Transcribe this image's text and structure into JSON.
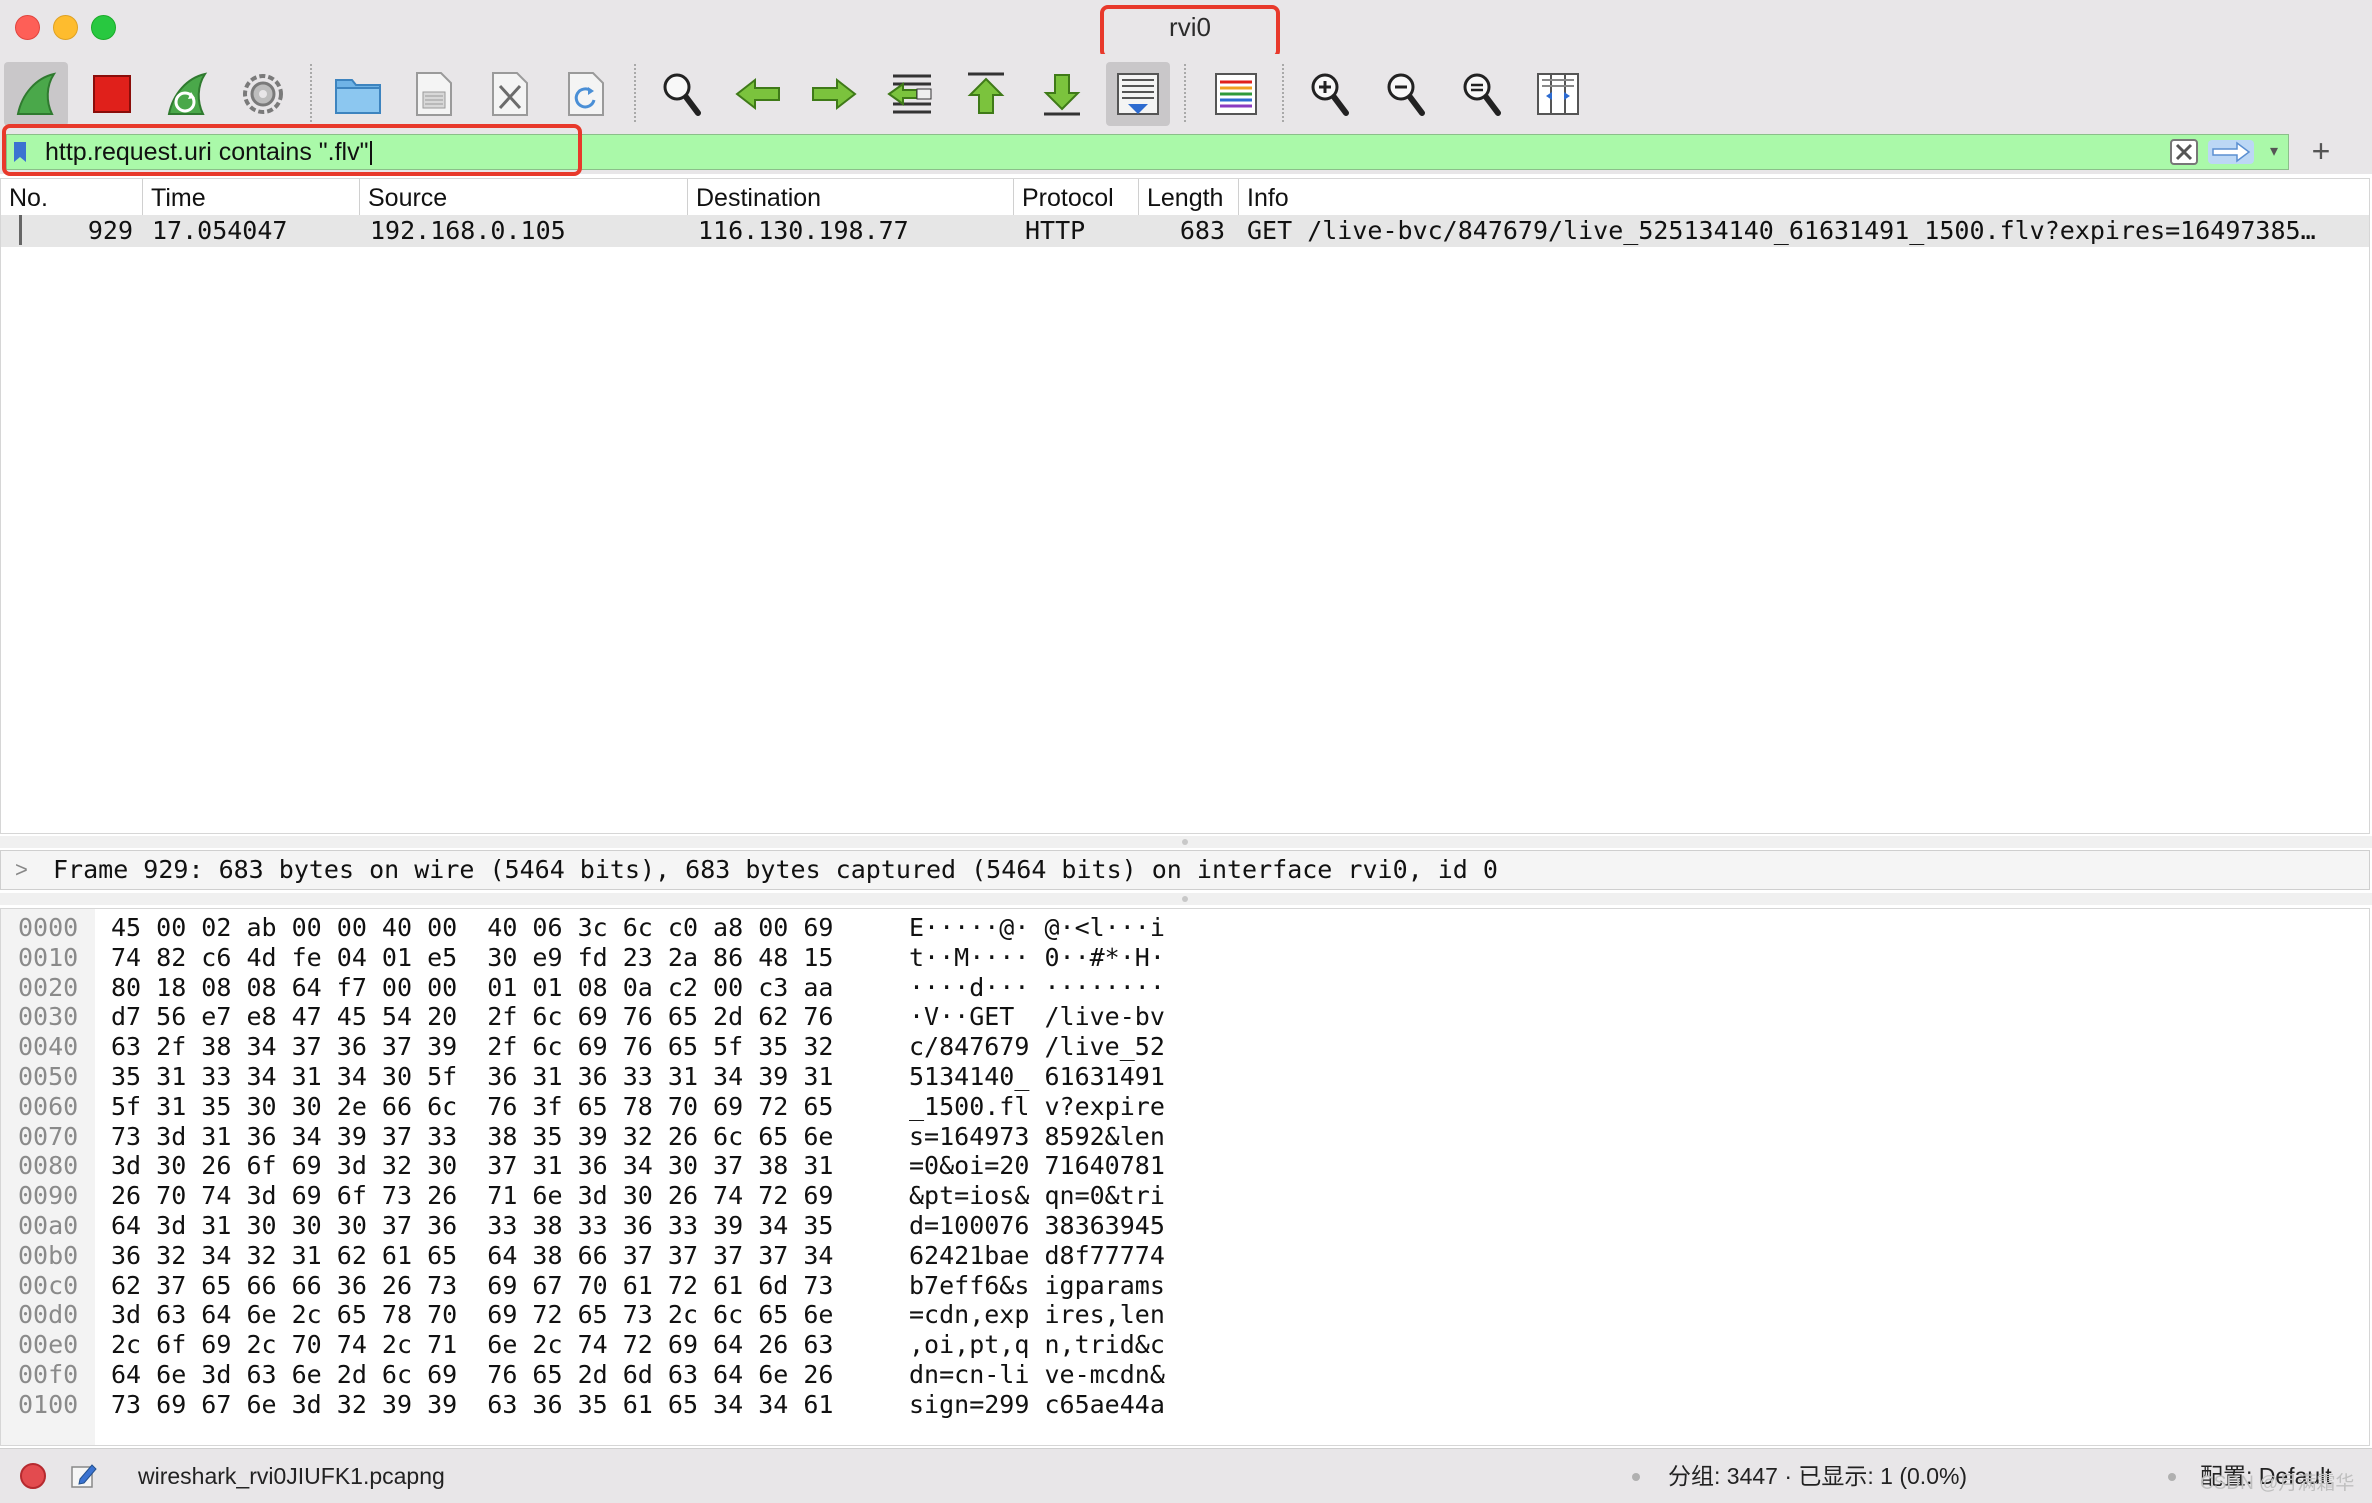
{
  "window": {
    "title": "rvi0"
  },
  "toolbar": {
    "icons": [
      "shark-fin-start-icon",
      "stop-square-icon",
      "restart-fin-icon",
      "gear-options-icon",
      "open-folder-icon",
      "save-file-icon",
      "close-file-icon",
      "reload-icon",
      "find-magnifier-icon",
      "go-back-arrow-icon",
      "go-forward-arrow-icon",
      "go-to-packet-icon",
      "first-packet-icon",
      "last-packet-icon",
      "autoscroll-icon",
      "colorize-icon",
      "zoom-in-icon",
      "zoom-out-icon",
      "zoom-normal-icon",
      "resize-columns-icon"
    ]
  },
  "filter": {
    "value": "http.request.uri contains \".flv\"",
    "background": "#aaf9a9"
  },
  "packet_list": {
    "columns": [
      "No.",
      "Time",
      "Source",
      "Destination",
      "Protocol",
      "Length",
      "Info"
    ],
    "rows": [
      {
        "no": "929",
        "time": "17.054047",
        "source": "192.168.0.105",
        "destination": "116.130.198.77",
        "protocol": "HTTP",
        "length": "683",
        "info": "GET /live-bvc/847679/live_525134140_61631491_1500.flv?expires=16497385…"
      }
    ]
  },
  "details": {
    "summary": "Frame 929: 683 bytes on wire (5464 bits), 683 bytes captured (5464 bits) on interface rvi0, id 0"
  },
  "hex_dump": [
    {
      "offset": "0000",
      "bytes": "45 00 02 ab 00 00 40 00  40 06 3c 6c c0 a8 00 69",
      "ascii": "E·····@· @·<l···i"
    },
    {
      "offset": "0010",
      "bytes": "74 82 c6 4d fe 04 01 e5  30 e9 fd 23 2a 86 48 15",
      "ascii": "t··M···· 0··#*·H·"
    },
    {
      "offset": "0020",
      "bytes": "80 18 08 08 64 f7 00 00  01 01 08 0a c2 00 c3 aa",
      "ascii": "····d··· ········"
    },
    {
      "offset": "0030",
      "bytes": "d7 56 e7 e8 47 45 54 20  2f 6c 69 76 65 2d 62 76",
      "ascii": "·V··GET  /live-bv"
    },
    {
      "offset": "0040",
      "bytes": "63 2f 38 34 37 36 37 39  2f 6c 69 76 65 5f 35 32",
      "ascii": "c/847679 /live_52"
    },
    {
      "offset": "0050",
      "bytes": "35 31 33 34 31 34 30 5f  36 31 36 33 31 34 39 31",
      "ascii": "5134140_ 61631491"
    },
    {
      "offset": "0060",
      "bytes": "5f 31 35 30 30 2e 66 6c  76 3f 65 78 70 69 72 65",
      "ascii": "_1500.fl v?expire"
    },
    {
      "offset": "0070",
      "bytes": "73 3d 31 36 34 39 37 33  38 35 39 32 26 6c 65 6e",
      "ascii": "s=164973 8592&len"
    },
    {
      "offset": "0080",
      "bytes": "3d 30 26 6f 69 3d 32 30  37 31 36 34 30 37 38 31",
      "ascii": "=0&oi=20 71640781"
    },
    {
      "offset": "0090",
      "bytes": "26 70 74 3d 69 6f 73 26  71 6e 3d 30 26 74 72 69",
      "ascii": "&pt=ios& qn=0&tri"
    },
    {
      "offset": "00a0",
      "bytes": "64 3d 31 30 30 30 37 36  33 38 33 36 33 39 34 35",
      "ascii": "d=100076 38363945"
    },
    {
      "offset": "00b0",
      "bytes": "36 32 34 32 31 62 61 65  64 38 66 37 37 37 37 34",
      "ascii": "62421bae d8f77774"
    },
    {
      "offset": "00c0",
      "bytes": "62 37 65 66 66 36 26 73  69 67 70 61 72 61 6d 73",
      "ascii": "b7eff6&s igparams"
    },
    {
      "offset": "00d0",
      "bytes": "3d 63 64 6e 2c 65 78 70  69 72 65 73 2c 6c 65 6e",
      "ascii": "=cdn,exp ires,len"
    },
    {
      "offset": "00e0",
      "bytes": "2c 6f 69 2c 70 74 2c 71  6e 2c 74 72 69 64 26 63",
      "ascii": ",oi,pt,q n,trid&c"
    },
    {
      "offset": "00f0",
      "bytes": "64 6e 3d 63 6e 2d 6c 69  76 65 2d 6d 63 64 6e 26",
      "ascii": "dn=cn-li ve-mcdn&"
    },
    {
      "offset": "0100",
      "bytes": "73 69 67 6e 3d 32 39 39  63 36 35 61 65 34 34 61",
      "ascii": "sign=299 c65ae44a"
    }
  ],
  "status": {
    "file": "wireshark_rvi0JIUFK1.pcapng",
    "packets": "分组: 3447 · 已显示: 1 (0.0%)",
    "profile": "配置: Default"
  },
  "watermark": "CSDN @月满霜华"
}
